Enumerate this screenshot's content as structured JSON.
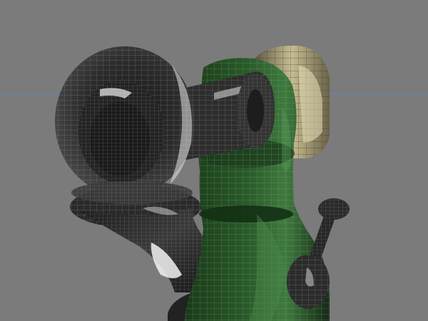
{
  "viewport": {
    "background": "#7b7b7b",
    "horizon_line_color": "#5f86b8",
    "shading": "wireframe-on-shaded",
    "objects": [
      {
        "name": "dark-metal-ring-part",
        "color": "#2a2a2a"
      },
      {
        "name": "dark-metal-base-arm",
        "color": "#262626"
      },
      {
        "name": "green-body-part",
        "color": "#1f4a1f"
      },
      {
        "name": "beige-cap-part",
        "color": "#8a8060"
      },
      {
        "name": "dark-lever-part",
        "color": "#202020"
      }
    ]
  }
}
